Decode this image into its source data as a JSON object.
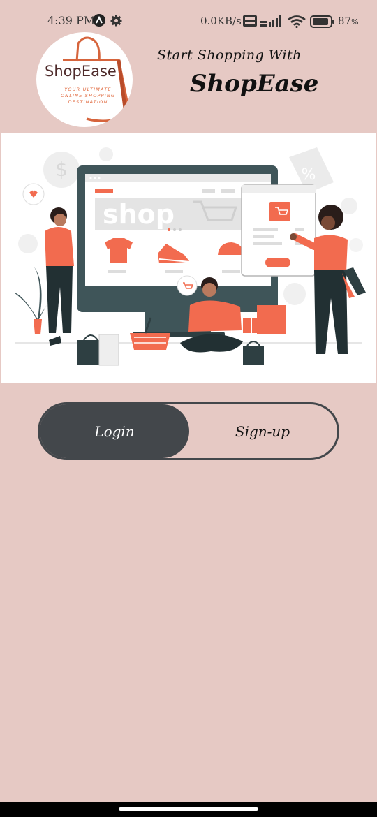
{
  "status_bar": {
    "time": "4:39 PM",
    "network_speed": "0.0KB/s",
    "battery_percent": "87",
    "battery_suffix": "%",
    "icons": [
      "a-app-icon",
      "gear-icon",
      "volte-icon",
      "signal-icon",
      "wifi-icon",
      "battery-icon"
    ]
  },
  "logo": {
    "name": "ShopEase",
    "tagline": "YOUR ULTIMATE ONLINE SHOPPING DESTINATION"
  },
  "header": {
    "subtitle": "Start Shopping With",
    "title": "ShopEase"
  },
  "hero": {
    "screen_text": "shop"
  },
  "auth": {
    "login_label": "Login",
    "signup_label": "Sign-up",
    "selected": "Login"
  },
  "colors": {
    "background": "#e6c9c4",
    "toggle_dark": "#43474b",
    "accent": "#f26b4f"
  }
}
